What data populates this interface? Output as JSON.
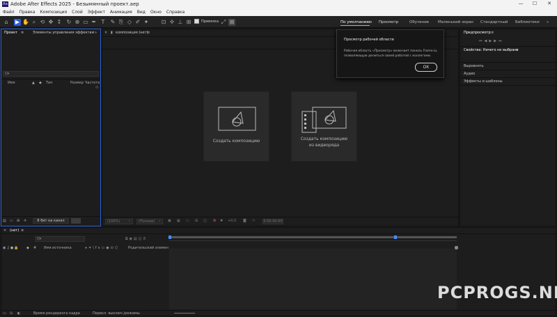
{
  "window": {
    "app_icon": "Ae",
    "title": "Adobe After Effects 2025 - Безымянный проект.aep"
  },
  "menu": [
    "Файл",
    "Правка",
    "Композиция",
    "Слой",
    "Эффект",
    "Анимация",
    "Вид",
    "Окно",
    "Справка"
  ],
  "toolbar": {
    "snap_label": "Привязка"
  },
  "workspaces": [
    {
      "label": "По умолчанию",
      "active": true
    },
    {
      "label": "Просмотр",
      "active": false
    },
    {
      "label": "Обучение",
      "active": false
    },
    {
      "label": "Маленький экран",
      "active": false
    },
    {
      "label": "Стандартный",
      "active": false
    },
    {
      "label": "Библиотеки",
      "active": false
    }
  ],
  "project_panel": {
    "tab_project": "Проект",
    "tab_effects": "Элементы управления эффектами (нет)",
    "search_placeholder": "Q▾",
    "columns": [
      "Имя",
      "Тип",
      "Размер",
      "Частота ..."
    ],
    "bit_depth": "8 бит на канал"
  },
  "composition_panel": {
    "tab": "композиция (нет)",
    "new_comp": "Создать композицию",
    "new_comp_footage_line1": "Создать композицию",
    "new_comp_footage_line2": "из видеоряда",
    "zoom": "(100%)",
    "resolution": "(Полное)",
    "exposure": "+0,0",
    "timecode": "0:00:00:00"
  },
  "popup": {
    "title": "Просмотр рабочей области",
    "body_line1": "Рабочая область «Просмотр» включает панель Frame.io,",
    "body_line2": "позволяющую делиться своей работой с коллегами.",
    "ok": "OK"
  },
  "right_panel": {
    "preview_tab": "Предпросмотр",
    "properties_tab": "Свойства: Ничего не выбрано",
    "items": [
      "Выровнять",
      "Аудио",
      "Эффекты и шаблоны"
    ]
  },
  "timeline": {
    "tab": "(нет)",
    "search_placeholder": "Q▾",
    "source_name": "Имя источника",
    "parent": "Родительский элемент и...",
    "render_time": "Время рендеринга кадра",
    "toggle": "Перекл. выключ./режимы"
  },
  "watermark": "PCPROGS.NET",
  "colors": {
    "accent": "#2d5dd8",
    "playhead": "#4a8cff"
  }
}
